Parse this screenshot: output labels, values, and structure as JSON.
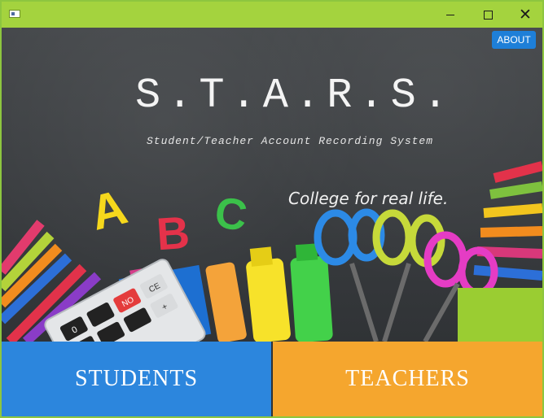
{
  "window": {
    "controls": {
      "minimize": "minimize-icon",
      "maximize": "maximize-icon",
      "close": "close-icon"
    }
  },
  "header": {
    "about_label": "ABOUT",
    "title": "S.T.A.R.S.",
    "subtitle": "Student/Teacher Account Recording System",
    "tagline": "College for real life."
  },
  "letters": [
    "A",
    "B",
    "C"
  ],
  "calculator_keys": [
    "0",
    "NO",
    "CE",
    "+"
  ],
  "buttons": {
    "students_label": "STUDENTS",
    "teachers_label": "TEACHERS"
  },
  "colors": {
    "titlebar": "#a4d33e",
    "about": "#1e7fd8",
    "students": "#2c86dd",
    "teachers": "#f5a62e"
  }
}
